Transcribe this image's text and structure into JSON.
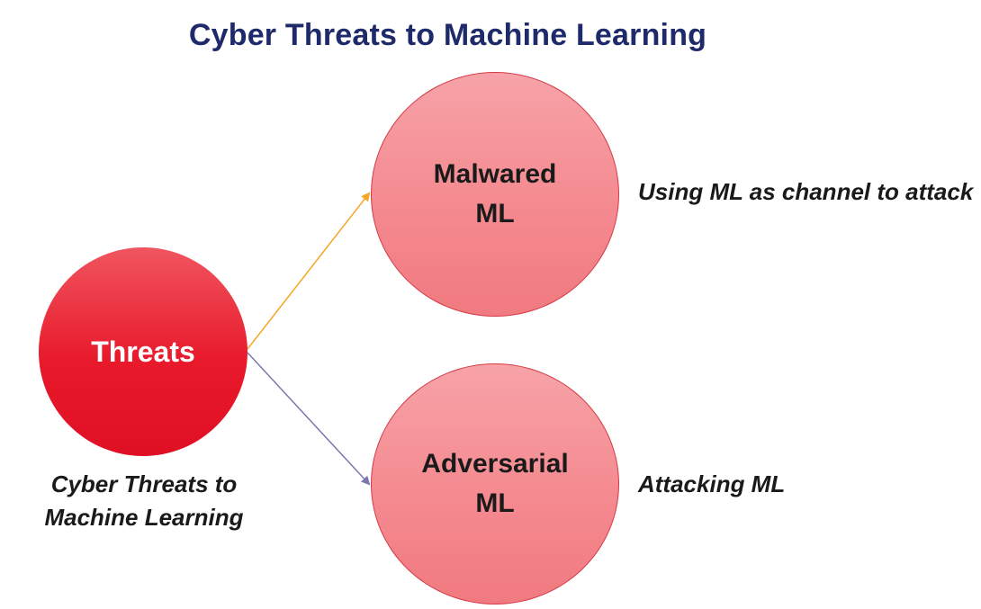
{
  "title": "Cyber Threats to Machine Learning",
  "nodes": {
    "threats": {
      "label": "Threats",
      "caption": "Cyber Threats to\nMachine Learning"
    },
    "malwared": {
      "label": "Malwared\nML",
      "caption": "Using ML as channel to attack"
    },
    "adversarial": {
      "label": "Adversarial\nML",
      "caption": "Attacking ML"
    }
  },
  "colors": {
    "title": "#1f2a6b",
    "threats_fill": "#e8192b",
    "child_fill": "#f48a90",
    "arrow_malwared": "#f5a623",
    "arrow_adversarial": "#7b78b0"
  }
}
